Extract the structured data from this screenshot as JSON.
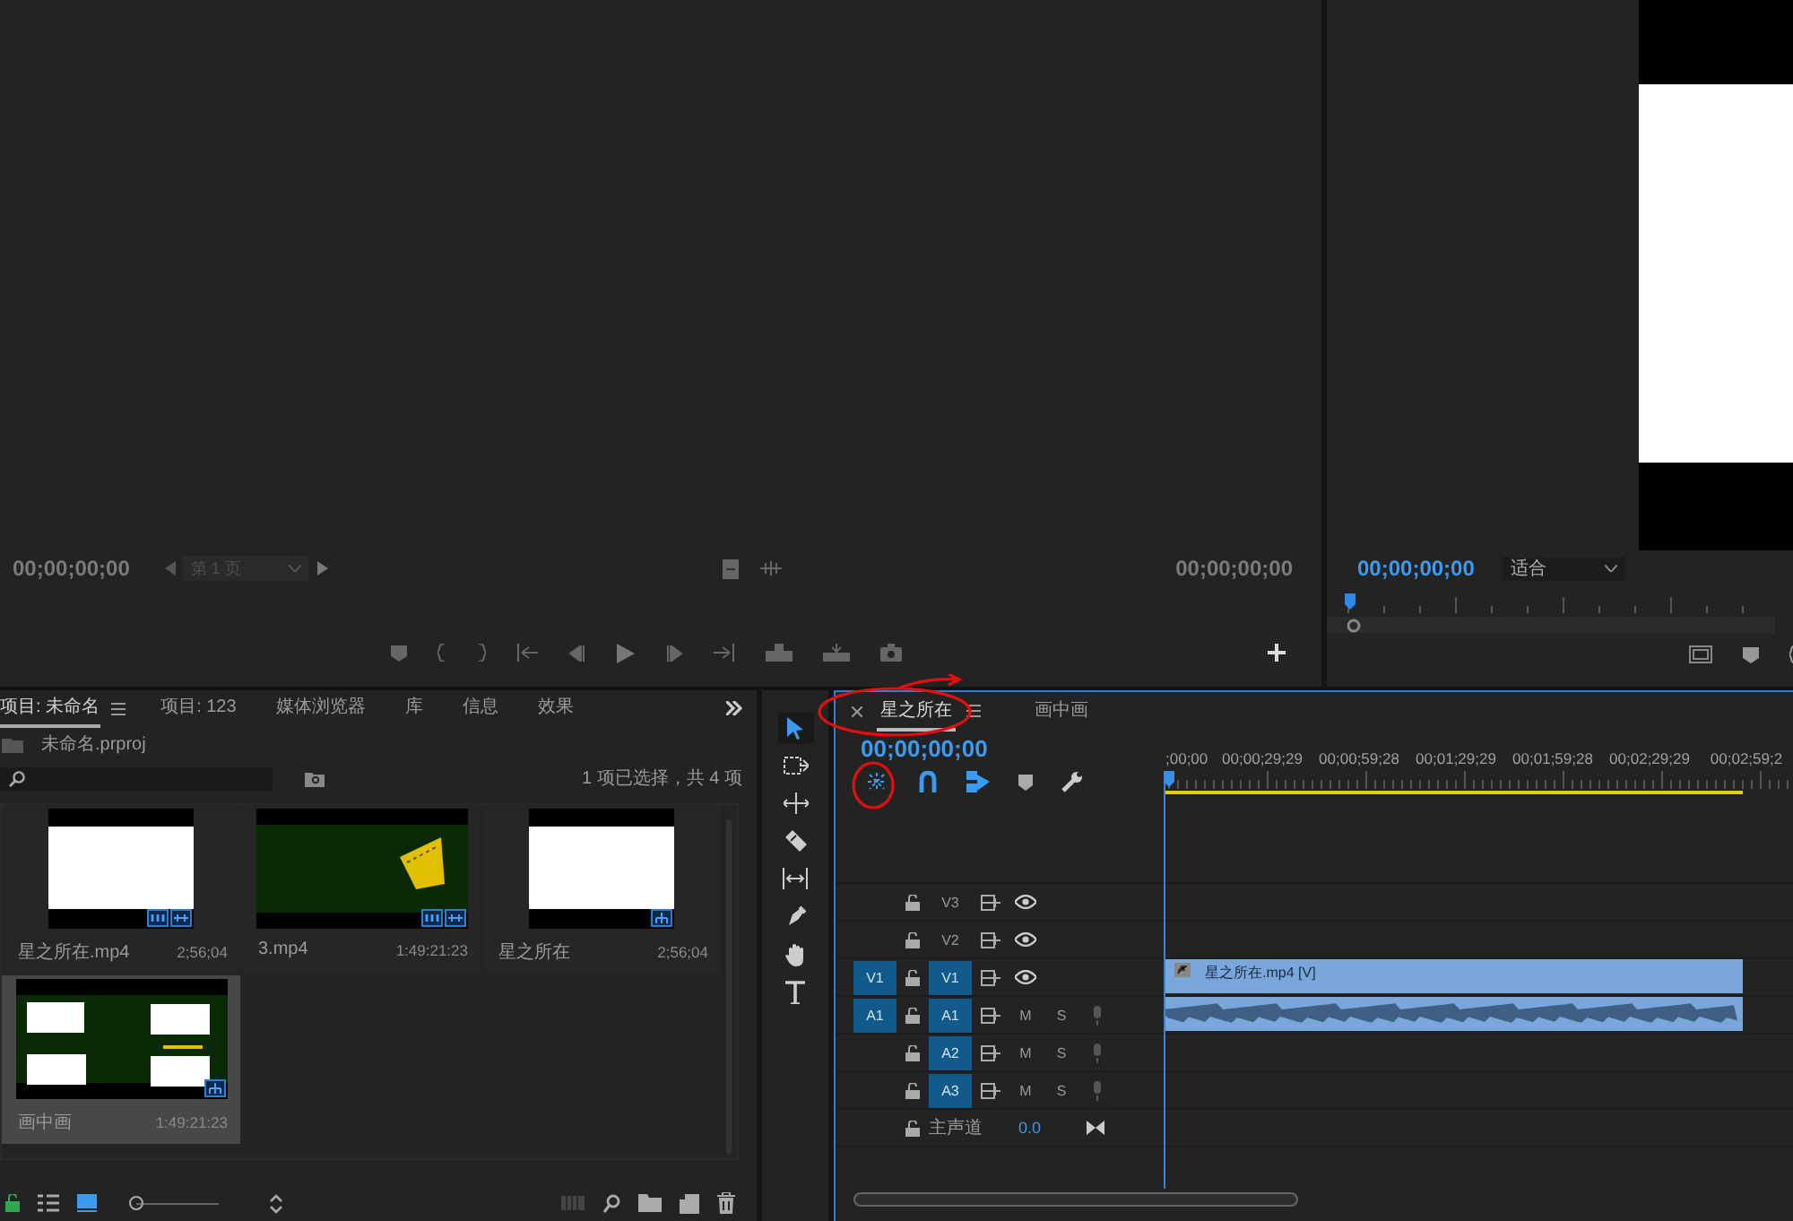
{
  "source_monitor": {
    "timecode": "00;00;00;00",
    "page_select": "第 1 页",
    "duration": "00;00;00;00"
  },
  "program_monitor": {
    "timecode": "00;00;00;00",
    "zoom_select": "适合"
  },
  "project_panel": {
    "tabs": [
      {
        "label": "项目: 未命名",
        "selected": true
      },
      {
        "label": "项目: 123",
        "selected": false
      },
      {
        "label": "媒体浏览器",
        "selected": false
      },
      {
        "label": "库",
        "selected": false
      },
      {
        "label": "信息",
        "selected": false
      },
      {
        "label": "效果",
        "selected": false
      }
    ],
    "project_file": "未命名.prproj",
    "selection_info": "1 项已选择，共 4 项",
    "items": [
      {
        "name": "星之所在.mp4",
        "duration": "2;56;04",
        "kind": "clip",
        "selected": false
      },
      {
        "name": "3.mp4",
        "duration": "1:49:21:23",
        "kind": "clip",
        "selected": false
      },
      {
        "name": "星之所在",
        "duration": "2;56;04",
        "kind": "sequence",
        "selected": false
      },
      {
        "name": "画中画",
        "duration": "1:49:21:23",
        "kind": "sequence",
        "selected": true
      }
    ],
    "view_buttons": [
      {
        "kind": "list",
        "selected": false
      },
      {
        "kind": "icon",
        "selected": true
      }
    ],
    "zoom_slider": {
      "level": 0
    }
  },
  "timeline": {
    "tabs": [
      {
        "label": "星之所在",
        "selected": true
      },
      {
        "label": "画中画",
        "selected": false
      }
    ],
    "timecode": "00;00;00;00",
    "ruler_labels": [
      ";00;00",
      "00;00;29;29",
      "00;00;59;28",
      "00;01;29;29",
      "00;01;59;28",
      "00;02;29;29",
      "00;02;59;2"
    ],
    "video_tracks": [
      {
        "label": "V3",
        "targeted": false
      },
      {
        "label": "V2",
        "targeted": false
      },
      {
        "label": "V1",
        "targeted": true,
        "source": "V1",
        "clip": "星之所在.mp4 [V]"
      }
    ],
    "audio_tracks": [
      {
        "label": "A1",
        "targeted": true,
        "source": "A1",
        "mute": "M",
        "solo": "S",
        "clip": {
          "kind": "audio"
        }
      },
      {
        "label": "A2",
        "targeted": true,
        "mute": "M",
        "solo": "S"
      },
      {
        "label": "A3",
        "targeted": true,
        "mute": "M",
        "solo": "S"
      }
    ],
    "master": {
      "label": "主声道",
      "value": "0.0"
    }
  }
}
